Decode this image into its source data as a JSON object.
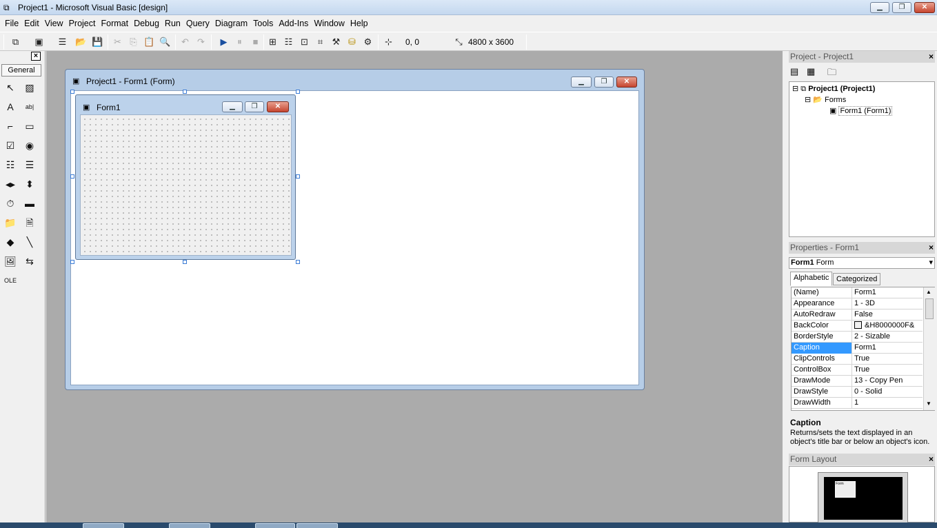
{
  "window": {
    "title": "Project1 - Microsoft Visual Basic [design]",
    "min_label": "▁",
    "max_label": "❐",
    "close_label": "✕"
  },
  "menu": [
    "File",
    "Edit",
    "View",
    "Project",
    "Format",
    "Debug",
    "Run",
    "Query",
    "Diagram",
    "Tools",
    "Add-Ins",
    "Window",
    "Help"
  ],
  "toolbar": {
    "position": "0, 0",
    "size": "4800 x 3600",
    "icons": {
      "add_project": "⧉",
      "add_form": "▣",
      "menu_editor": "☰",
      "open": "📂",
      "save": "💾",
      "cut": "✂",
      "copy": "⎘",
      "paste": "📋",
      "find": "🔍",
      "undo": "↶",
      "redo": "↷",
      "start": "▶",
      "break": "⏸",
      "end": "■",
      "project_explorer": "⊞",
      "properties_window": "☷",
      "form_layout": "⊡",
      "object_browser": "⌗",
      "toolbox": "⚒",
      "data_view": "⛁",
      "component_manager": "⚙",
      "position_icon": "⊹",
      "size_icon": "⤡"
    }
  },
  "toolbox": {
    "close": "×",
    "tab": "General",
    "tools": [
      {
        "name": "pointer-tool",
        "glyph": "↖"
      },
      {
        "name": "picturebox-tool",
        "glyph": "▨"
      },
      {
        "name": "label-tool",
        "glyph": "A"
      },
      {
        "name": "textbox-tool",
        "glyph": "ab|"
      },
      {
        "name": "frame-tool",
        "glyph": "⌐"
      },
      {
        "name": "commandbutton-tool",
        "glyph": "▭"
      },
      {
        "name": "checkbox-tool",
        "glyph": "☑"
      },
      {
        "name": "optionbutton-tool",
        "glyph": "◉"
      },
      {
        "name": "combobox-tool",
        "glyph": "☷"
      },
      {
        "name": "listbox-tool",
        "glyph": "☰"
      },
      {
        "name": "hscrollbar-tool",
        "glyph": "◂▸"
      },
      {
        "name": "vscrollbar-tool",
        "glyph": "⬍"
      },
      {
        "name": "timer-tool",
        "glyph": "⏱"
      },
      {
        "name": "drivelistbox-tool",
        "glyph": "▬"
      },
      {
        "name": "dirlistbox-tool",
        "glyph": "📁"
      },
      {
        "name": "filelistbox-tool",
        "glyph": "🗎"
      },
      {
        "name": "shape-tool",
        "glyph": "◆"
      },
      {
        "name": "line-tool",
        "glyph": "╲"
      },
      {
        "name": "image-tool",
        "glyph": "🖼"
      },
      {
        "name": "data-tool",
        "glyph": "⇆"
      },
      {
        "name": "ole-tool",
        "glyph": "OLE"
      }
    ]
  },
  "designer": {
    "title": "Project1 - Form1 (Form)",
    "icon": "▣",
    "form": {
      "title": "Form1",
      "icon": "▣"
    }
  },
  "project_panel": {
    "title": "Project - Project1",
    "close": "×",
    "buttons": {
      "view_code": "▤",
      "view_object": "▦",
      "toggle_folders": "🗀"
    },
    "tree": [
      {
        "label": "Project1 (Project1)",
        "expander": "⊟",
        "icon": "⧉"
      },
      {
        "label": "Forms",
        "expander": "⊟",
        "icon": "📂"
      },
      {
        "label": "Form1 (Form1)",
        "icon": "▣"
      }
    ]
  },
  "properties_panel": {
    "title": "Properties - Form1",
    "close": "×",
    "object_name": "Form1",
    "object_type": "Form",
    "combo_arrow": "▾",
    "tabs": [
      "Alphabetic",
      "Categorized"
    ],
    "rows": [
      {
        "name": "(Name)",
        "value": "Form1"
      },
      {
        "name": "Appearance",
        "value": "1 - 3D"
      },
      {
        "name": "AutoRedraw",
        "value": "False"
      },
      {
        "name": "BackColor",
        "value": "&H8000000F&"
      },
      {
        "name": "BorderStyle",
        "value": "2 - Sizable"
      },
      {
        "name": "Caption",
        "value": "Form1"
      },
      {
        "name": "ClipControls",
        "value": "True"
      },
      {
        "name": "ControlBox",
        "value": "True"
      },
      {
        "name": "DrawMode",
        "value": "13 - Copy Pen"
      },
      {
        "name": "DrawStyle",
        "value": "0 - Solid"
      },
      {
        "name": "DrawWidth",
        "value": "1"
      }
    ],
    "selected_row": "Caption",
    "scroll_up": "▲",
    "scroll_down": "▼",
    "description_name": "Caption",
    "description_text": "Returns/sets the text displayed in an object's title bar or below an object's icon."
  },
  "form_layout_panel": {
    "title": "Form Layout",
    "close": "×",
    "mini_form_label": "Form"
  },
  "colors": {
    "selection": "#3399ff",
    "workspace": "#ababab",
    "window_frame": "#b6cde7"
  }
}
